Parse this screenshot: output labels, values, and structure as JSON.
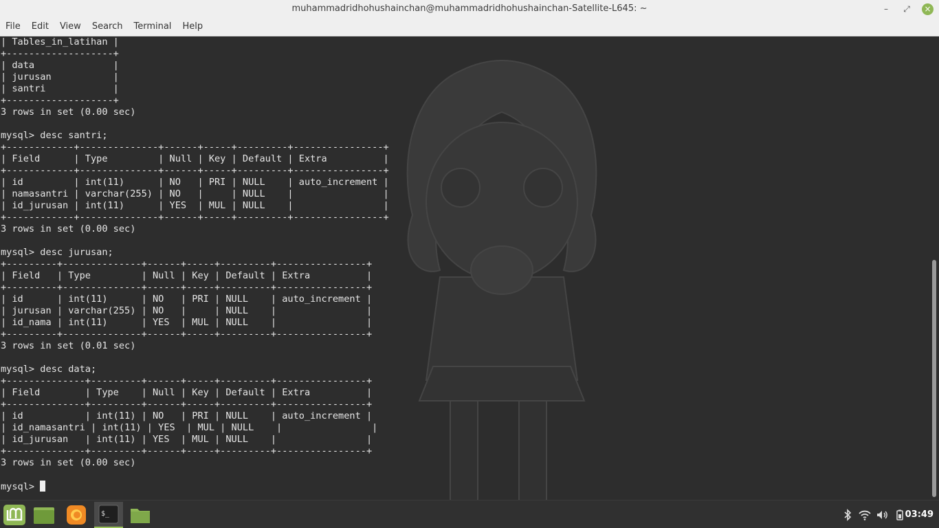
{
  "window": {
    "title": "muhammadridhohushainchan@muhammadridhohushainchan-Satellite-L645: ~"
  },
  "menu": [
    "File",
    "Edit",
    "View",
    "Search",
    "Terminal",
    "Help"
  ],
  "terminal": {
    "lines": [
      "| Tables_in_latihan |",
      "+-------------------+",
      "| data              |",
      "| jurusan           |",
      "| santri            |",
      "+-------------------+",
      "3 rows in set (0.00 sec)",
      "",
      "mysql> desc santri;",
      "+------------+--------------+------+-----+---------+----------------+",
      "| Field      | Type         | Null | Key | Default | Extra          |",
      "+------------+--------------+------+-----+---------+----------------+",
      "| id         | int(11)      | NO   | PRI | NULL    | auto_increment |",
      "| namasantri | varchar(255) | NO   |     | NULL    |                |",
      "| id_jurusan | int(11)      | YES  | MUL | NULL    |                |",
      "+------------+--------------+------+-----+---------+----------------+",
      "3 rows in set (0.00 sec)",
      "",
      "mysql> desc jurusan;",
      "+---------+--------------+------+-----+---------+----------------+",
      "| Field   | Type         | Null | Key | Default | Extra          |",
      "+---------+--------------+------+-----+---------+----------------+",
      "| id      | int(11)      | NO   | PRI | NULL    | auto_increment |",
      "| jurusan | varchar(255) | NO   |     | NULL    |                |",
      "| id_nama | int(11)      | YES  | MUL | NULL    |                |",
      "+---------+--------------+------+-----+---------+----------------+",
      "3 rows in set (0.01 sec)",
      "",
      "mysql> desc data;",
      "+--------------+---------+------+-----+---------+----------------+",
      "| Field        | Type    | Null | Key | Default | Extra          |",
      "+--------------+---------+------+-----+---------+----------------+",
      "| id           | int(11) | NO   | PRI | NULL    | auto_increment |",
      "| id_namasantri | int(11) | YES  | MUL | NULL    |                |",
      "| id_jurusan   | int(11) | YES  | MUL | NULL    |                |",
      "+--------------+---------+------+-----+---------+----------------+",
      "3 rows in set (0.00 sec)",
      "",
      "mysql> "
    ]
  },
  "taskbar": {
    "apps": [
      "mint-menu-icon",
      "files-icon",
      "firefox-icon",
      "terminal-icon",
      "folder-icon"
    ],
    "active_app": "terminal-icon",
    "tray": [
      "bluetooth-icon",
      "wifi-icon",
      "volume-icon",
      "battery-icon"
    ],
    "clock": "03:49"
  },
  "colors": {
    "terminal_bg": "#2d2d2d",
    "terminal_fg": "#e6e6e6",
    "accent": "#8fb755"
  }
}
